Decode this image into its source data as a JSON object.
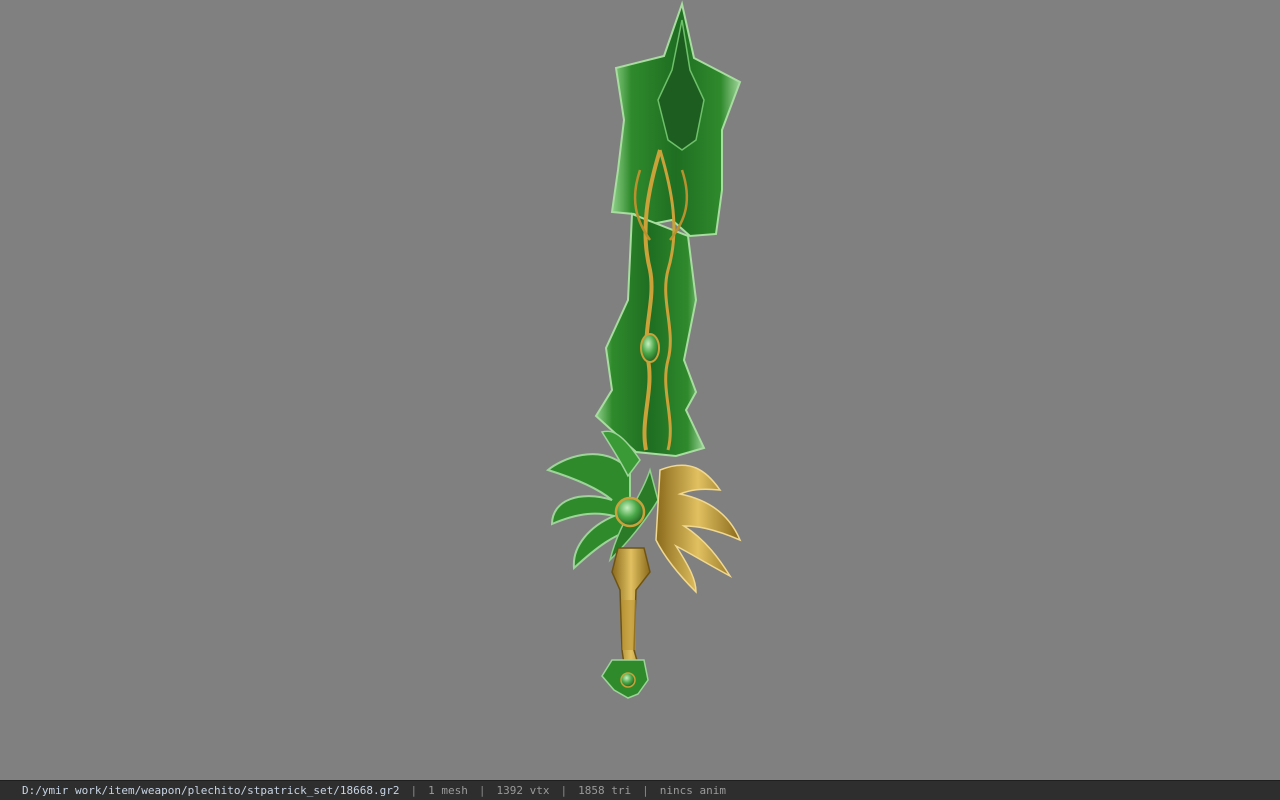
{
  "viewport": {
    "background_color": "#808080",
    "model_icon": "sword-model"
  },
  "statusbar": {
    "file_path": "D:/ymir work/item/weapon/plechito/stpatrick_set/18668.gr2",
    "separator": "|",
    "mesh_count": "1 mesh",
    "vertex_count": "1392 vtx",
    "triangle_count": "1858 tri",
    "anim_status": "nincs anim"
  },
  "colors": {
    "blade_green": "#2f8a2c",
    "blade_dark": "#1e5e1e",
    "edge_light": "#8fd08a",
    "gold": "#c9a23a",
    "gold_dark": "#8a6a1c",
    "statusbar_bg": "#2e2e2e",
    "path_text": "#c8d4e4"
  }
}
